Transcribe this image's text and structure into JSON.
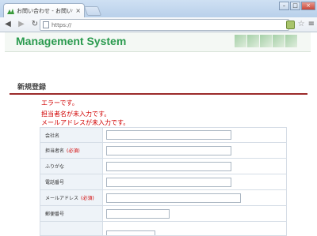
{
  "browser": {
    "tab_title": "お問い合わせ - お問い合わせ",
    "url": "https://",
    "colors": {
      "tab_bar": "#b9d0ea",
      "close_button": "#c9483a"
    }
  },
  "header": {
    "system_title": "Management System",
    "title_color": "#2a9a4e"
  },
  "section": {
    "title": "新規登録",
    "rule_color": "#9b2a2a"
  },
  "errors": {
    "heading": "エラーです。",
    "messages": [
      "担当者名が未入力です。",
      "メールアドレスが未入力です。"
    ],
    "color": "#d10000"
  },
  "form": {
    "required_mark": "(必須)",
    "fields": [
      {
        "label": "会社名",
        "required": false
      },
      {
        "label": "担当者名",
        "required": true
      },
      {
        "label": "ふりがな",
        "required": false
      },
      {
        "label": "電話番号",
        "required": false
      },
      {
        "label": "メールアドレス",
        "required": true
      },
      {
        "label": "郵便番号",
        "required": false
      }
    ]
  }
}
